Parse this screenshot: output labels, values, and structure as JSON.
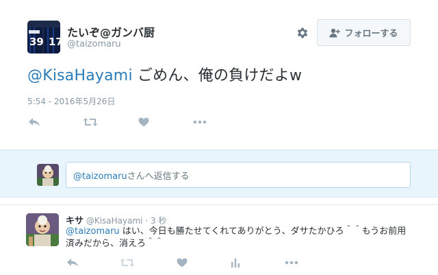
{
  "main_tweet": {
    "display_name": "たいぞ@ガンバ厨",
    "handle": "@taizomaru",
    "follow_label": "フォローする",
    "text_mention": "@KisaHayami",
    "text_body": " ごめん、俺の負けだよw",
    "timestamp": "5:54 - 2016年5月26日",
    "avatar_numbers": [
      "39",
      "17"
    ]
  },
  "compose": {
    "mention": "@taizomaru",
    "placeholder_suffix": "さんへ返信する"
  },
  "reply": {
    "display_name": "キサ",
    "handle": "@KisaHayami",
    "separator": " · ",
    "time": "3 秒",
    "mention": "@taizomaru",
    "body": " はい、今日も勝たせてくれてありがとう、ダサたかひろ＾＾もうお前用済みだから、消えろ＾＾"
  },
  "icons": {
    "settings": "gear-icon",
    "follow": "add-user-icon",
    "reply": "reply-icon",
    "retweet": "retweet-icon",
    "like": "heart-icon",
    "analytics": "bar-chart-icon",
    "more": "more-icon"
  },
  "colors": {
    "mention": "#2b7bb9",
    "icon": "#a4b5c1",
    "compose_bg": "#e8f5fd",
    "muted": "#8899a6"
  }
}
